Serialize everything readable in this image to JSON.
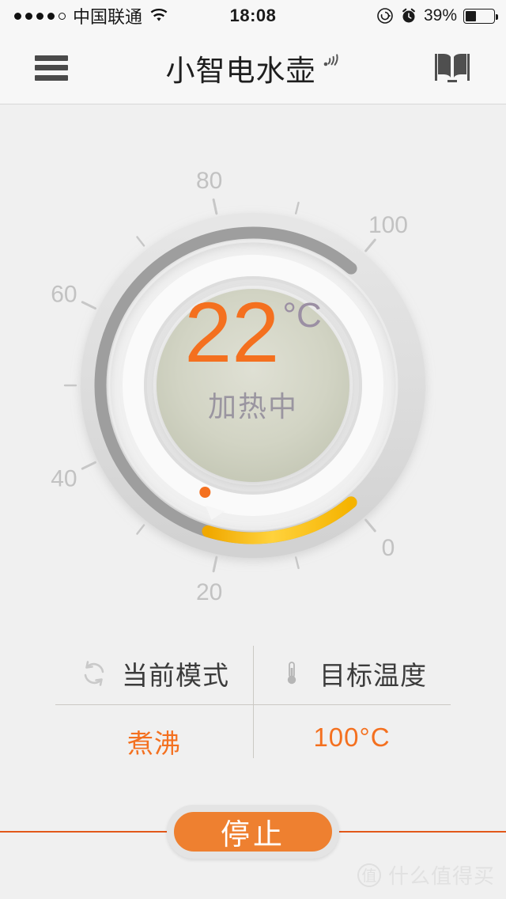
{
  "status_bar": {
    "signal_dots_filled": 4,
    "signal_dots_total": 5,
    "carrier": "中国联通",
    "wifi_icon": "wifi-icon",
    "time": "18:08",
    "rotation_lock_icon": "rotation-lock-icon",
    "alarm_icon": "alarm-clock-icon",
    "battery_percent": "39%",
    "battery_level": 39
  },
  "nav_bar": {
    "menu_icon": "hamburger-menu-icon",
    "title": "小智电水壶",
    "signal_icon": "device-signal-icon",
    "book_icon": "open-book-icon"
  },
  "gauge": {
    "current_temperature": "22",
    "unit": "°C",
    "status_text": "加热中",
    "min": 0,
    "max": 100,
    "target_value": 100,
    "tick_labels": [
      "0",
      "20",
      "40",
      "60",
      "80",
      "100"
    ],
    "tick_values": [
      0,
      20,
      40,
      60,
      80,
      100
    ],
    "minor_tick_values": [
      10,
      30,
      50,
      70,
      90
    ],
    "progress_color": "#fbbe10",
    "target_arc_color": "#9e9e9e",
    "bezel_color": "#dedede",
    "face_color": "#cdd0bf",
    "marker_dot_color": "#f4701f"
  },
  "info_panel": {
    "mode": {
      "icon": "refresh-icon",
      "label": "当前模式",
      "value": "煮沸"
    },
    "target": {
      "icon": "thermometer-icon",
      "label": "目标温度",
      "value": "100°C"
    }
  },
  "action": {
    "stop_label": "停止",
    "button_color": "#ee8030",
    "line_color": "#e2581a"
  },
  "watermark": {
    "logo_text": "值",
    "text": "什么值得买"
  }
}
